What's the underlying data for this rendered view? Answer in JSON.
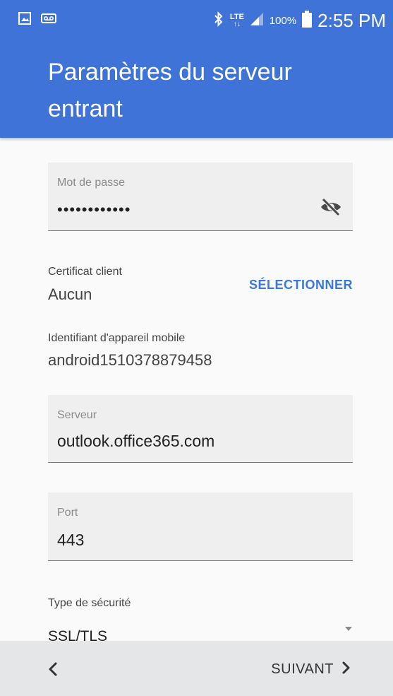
{
  "status_bar": {
    "lte": "LTE",
    "battery_percent": "100%",
    "time": "2:55 PM"
  },
  "header": {
    "title": "Paramètres du serveur entrant"
  },
  "password": {
    "label": "Mot de passe",
    "value": "••••••••••••",
    "toggle_icon": "visibility-off-icon"
  },
  "client_certificate": {
    "label": "Certificat client",
    "value": "Aucun",
    "select_label": "SÉLECTIONNER"
  },
  "device_id": {
    "label": "Identifiant d'appareil mobile",
    "value": "android1510378879458"
  },
  "server": {
    "label": "Serveur",
    "value": "outlook.office365.com"
  },
  "port": {
    "label": "Port",
    "value": "443"
  },
  "security_type": {
    "label": "Type de sécurité",
    "selected": "SSL/TLS"
  },
  "bottom_bar": {
    "next_label": "SUIVANT"
  },
  "colors": {
    "accent": "#3f73d8",
    "link": "#3a78e0",
    "field_background": "#efefef",
    "bottom_bar": "#e4e6e8"
  }
}
